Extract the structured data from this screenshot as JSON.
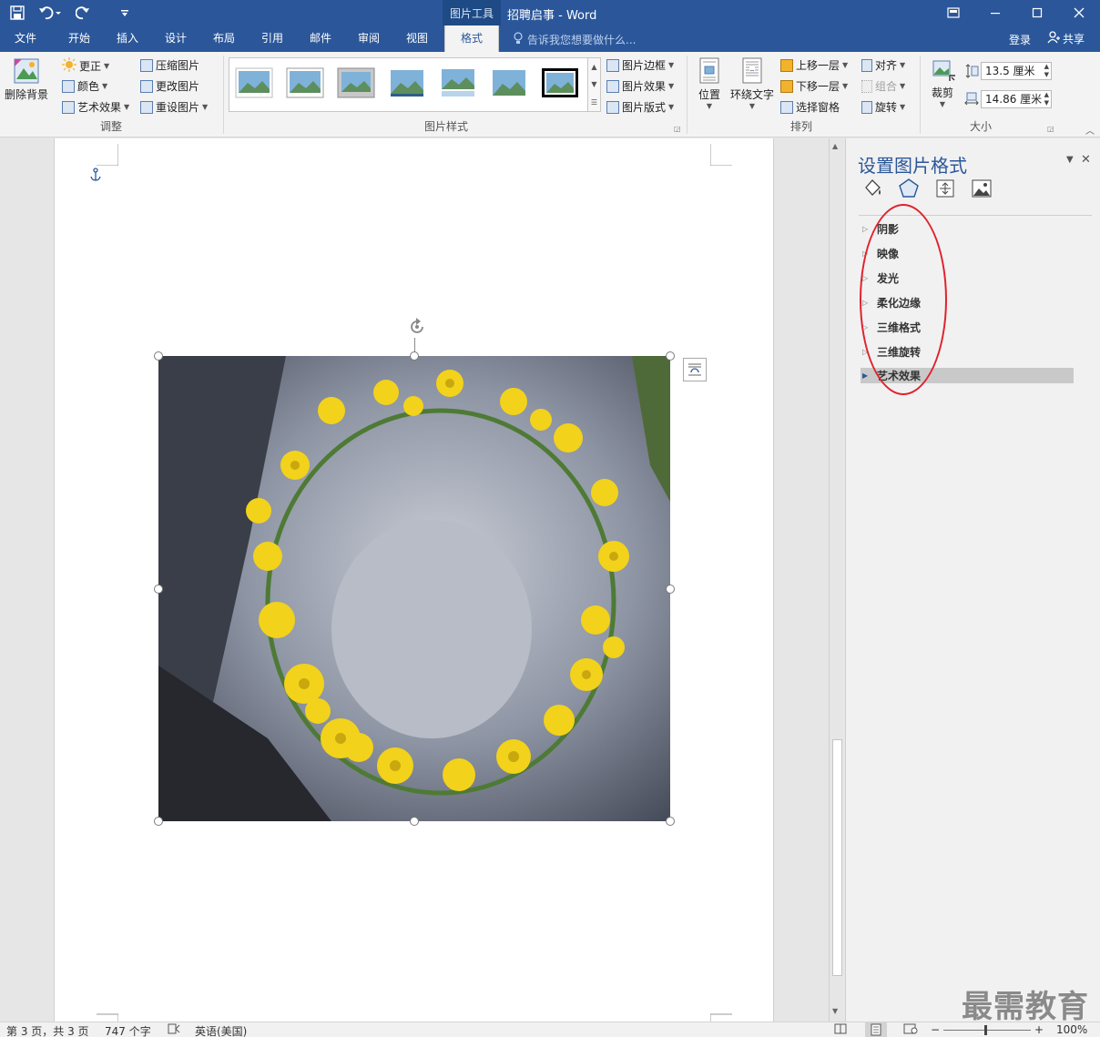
{
  "titlebar": {
    "context_tab": "图片工具",
    "title": "招聘启事 - Word",
    "qat_icons": [
      "save-icon",
      "undo-icon",
      "redo-icon",
      "customize-icon"
    ]
  },
  "tabs": [
    {
      "label": "文件"
    },
    {
      "label": "开始"
    },
    {
      "label": "插入"
    },
    {
      "label": "设计"
    },
    {
      "label": "布局"
    },
    {
      "label": "引用"
    },
    {
      "label": "邮件"
    },
    {
      "label": "审阅"
    },
    {
      "label": "视图"
    },
    {
      "label": "格式",
      "active": true
    }
  ],
  "tellme": "告诉我您想要做什么...",
  "login": "登录",
  "share": "共享",
  "ribbon": {
    "adjust": {
      "remove_bg": "删除背景",
      "corrections": "更正",
      "color": "颜色",
      "art_effects": "艺术效果",
      "compress": "压缩图片",
      "change": "更改图片",
      "reset": "重设图片",
      "label": "调整"
    },
    "styles": {
      "border": "图片边框",
      "effects": "图片效果",
      "layout": "图片版式",
      "label": "图片样式"
    },
    "arrange": {
      "position": "位置",
      "wrap": "环绕文字",
      "forward": "上移一层",
      "backward": "下移一层",
      "selection_pane": "选择窗格",
      "align": "对齐",
      "group": "组合",
      "rotate": "旋转",
      "label": "排列"
    },
    "size": {
      "crop": "裁剪",
      "height": "13.5 厘米",
      "width": "14.86 厘米",
      "label": "大小"
    }
  },
  "pane": {
    "title": "设置图片格式",
    "sections": [
      {
        "label": "阴影"
      },
      {
        "label": "映像"
      },
      {
        "label": "发光"
      },
      {
        "label": "柔化边缘"
      },
      {
        "label": "三维格式"
      },
      {
        "label": "三维旋转"
      },
      {
        "label": "艺术效果",
        "highlighted": true
      }
    ]
  },
  "status": {
    "page": "第 3 页，共 3 页",
    "words": "747 个字",
    "language": "英语(美国)",
    "zoom": "100%"
  },
  "watermark": "最需教育",
  "colors": {
    "brand": "#2b579a",
    "annotation": "#e0222c"
  }
}
